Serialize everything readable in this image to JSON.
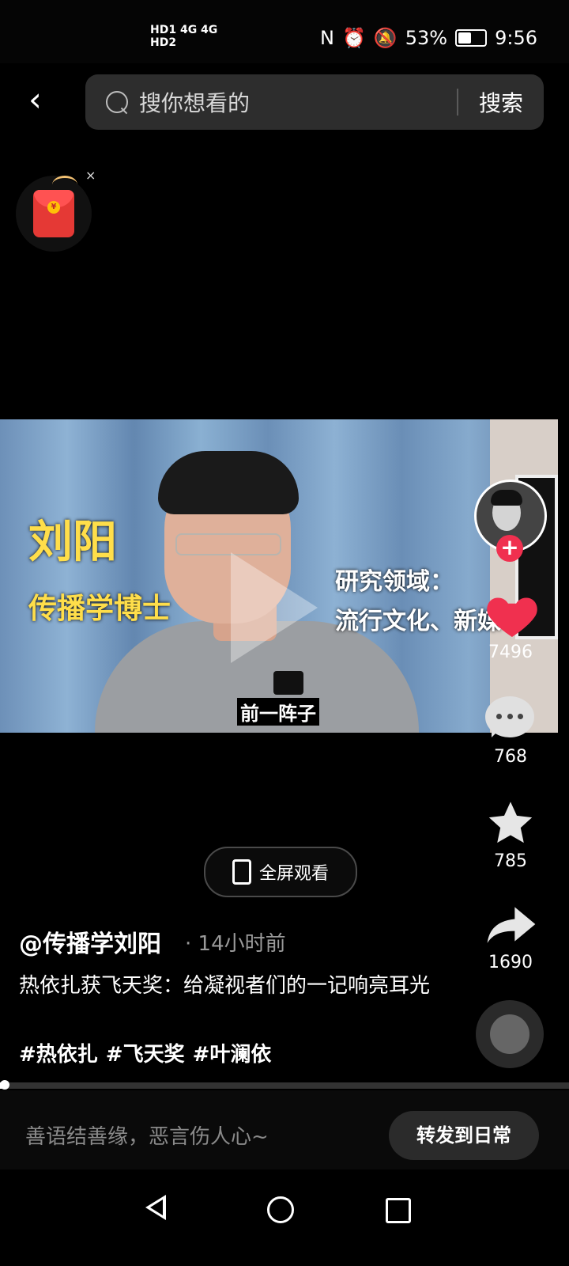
{
  "status_bar": {
    "network_left": "HD1 4G 4G",
    "network_right": "HD2",
    "battery": "53%",
    "time": "9:56",
    "battery_level": 0.53
  },
  "search": {
    "placeholder": "搜你想看的",
    "button": "搜索"
  },
  "video": {
    "overlay_name": "刘阳",
    "overlay_title": "传播学博士",
    "overlay_field_label": "研究领域：",
    "overlay_field_value": "流行文化、新媒",
    "subtitle": "前一阵子"
  },
  "actions": {
    "likes": "7496",
    "comments": "768",
    "favorites": "785",
    "shares": "1690"
  },
  "fullscreen_label": "全屏观看",
  "post": {
    "author": "@传播学刘阳",
    "time": "· 14小时前",
    "description": "热依扎获飞天奖：给凝视者们的一记响亮耳光",
    "tags": [
      "#热依扎",
      "#飞天奖",
      "#叶澜依"
    ]
  },
  "progress_value": 0.005,
  "comment_bar": {
    "placeholder": "善语结善缘，恶言伤人心~",
    "repost_button": "转发到日常"
  },
  "colors": {
    "like": "#f0304f",
    "caption_yellow": "#ffde4a"
  }
}
